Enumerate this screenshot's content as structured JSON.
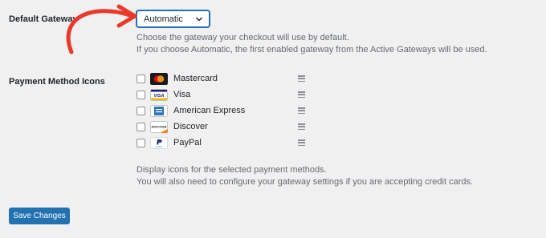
{
  "gateway": {
    "label": "Default Gateway",
    "selected": "Automatic",
    "help_line1": "Choose the gateway your checkout will use by default.",
    "help_line2": "If you choose Automatic, the first enabled gateway from the Active Gateways will be used."
  },
  "icons": {
    "label": "Payment Method Icons",
    "methods": [
      {
        "name": "Mastercard",
        "checked": false,
        "icon": "mastercard-icon"
      },
      {
        "name": "Visa",
        "checked": false,
        "icon": "visa-icon"
      },
      {
        "name": "American Express",
        "checked": false,
        "icon": "amex-icon"
      },
      {
        "name": "Discover",
        "checked": false,
        "icon": "discover-icon"
      },
      {
        "name": "PayPal",
        "checked": false,
        "icon": "paypal-icon"
      }
    ],
    "help_line1": "Display icons for the selected payment methods.",
    "help_line2": "You will also need to configure your gateway settings if you are accepting credit cards."
  },
  "card_logo_text": {
    "visa": "VISA",
    "discover": "DISCOVER",
    "paypal": "PayPal"
  },
  "actions": {
    "save_label": "Save Changes"
  },
  "colors": {
    "accent": "#2271b1",
    "annotation_arrow": "#e8392a",
    "background": "#f0f0f1"
  }
}
